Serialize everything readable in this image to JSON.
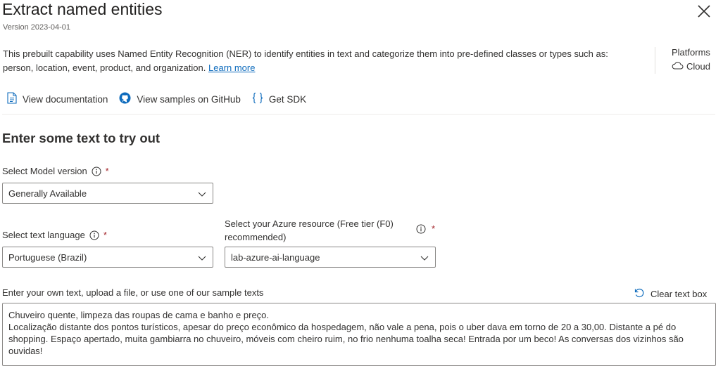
{
  "header": {
    "title": "Extract named entities",
    "version": "Version 2023-04-01"
  },
  "description": {
    "text": "This prebuilt capability uses Named Entity Recognition (NER) to identify entities in text and categorize them into pre-defined classes or types such as: person, location, event, product, and organization.",
    "learn_more": "Learn more"
  },
  "platforms": {
    "label": "Platforms",
    "value": "Cloud"
  },
  "links": {
    "documentation": "View documentation",
    "github": "View samples on GitHub",
    "sdk": "Get SDK"
  },
  "section": {
    "title": "Enter some text to try out"
  },
  "model_version": {
    "label": "Select Model version",
    "value": "Generally Available"
  },
  "language": {
    "label": "Select text language",
    "value": "Portuguese (Brazil)"
  },
  "resource": {
    "label_line1": "Select your Azure resource (Free tier (F0)",
    "label_line2": "recommended)",
    "value": "lab-azure-ai-language"
  },
  "text_input": {
    "label": "Enter your own text, upload a file, or use one of our sample texts",
    "clear_label": "Clear text box",
    "value": "Chuveiro quente, limpeza das roupas de cama e banho e preço.\nLocalização distante dos pontos turísticos, apesar do preço econômico da hospedagem, não vale a pena, pois o uber dava em torno de 20 a 30,00. Distante a pé do shopping. Espaço apertado, muita gambiarra no chuveiro, móveis com cheiro ruim, no frio nenhuma toalha seca! Entrada por um beco! As conversas dos vizinhos são ouvidas!"
  },
  "colors": {
    "link": "#0f6cbd",
    "required": "#a4262c",
    "border": "#8a8886",
    "text": "#323130"
  },
  "icons": [
    "close-icon",
    "document-icon",
    "github-icon",
    "code-braces-icon",
    "cloud-icon",
    "info-icon",
    "chevron-down-icon",
    "undo-icon"
  ]
}
